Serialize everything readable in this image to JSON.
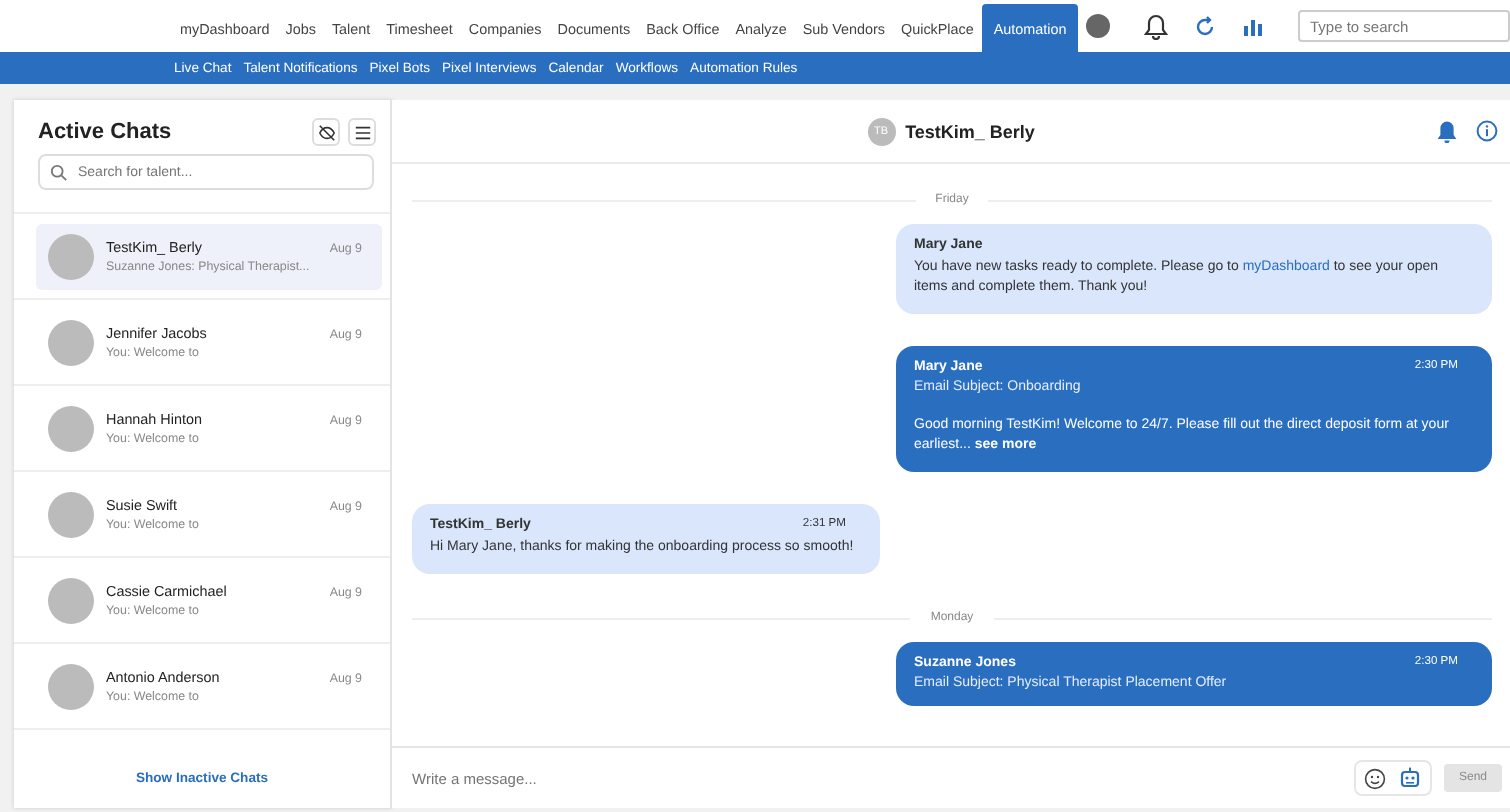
{
  "nav": {
    "items": [
      {
        "label": "myDashboard",
        "selected": false
      },
      {
        "label": "Jobs",
        "selected": false
      },
      {
        "label": "Talent",
        "selected": false
      },
      {
        "label": "Timesheet",
        "selected": false
      },
      {
        "label": "Companies",
        "selected": false
      },
      {
        "label": "Documents",
        "selected": false
      },
      {
        "label": "Back Office",
        "selected": false
      },
      {
        "label": "Analyze",
        "selected": false
      },
      {
        "label": "Sub Vendors",
        "selected": false
      },
      {
        "label": "QuickPlace",
        "selected": false
      },
      {
        "label": "Automation",
        "selected": true
      }
    ],
    "search": {
      "placeholder": "Type to search"
    }
  },
  "subnav": [
    "Live Chat",
    "Talent Notifications",
    "Pixel Bots",
    "Pixel Interviews",
    "Calendar",
    "Workflows",
    "Automation Rules"
  ],
  "sidebar": {
    "title": "Active Chats",
    "search": {
      "placeholder": "Search for talent..."
    },
    "chats": [
      {
        "name": "TestKim_ Berly",
        "preview": "Suzanne Jones: Physical Therapist...",
        "date": "Aug 9",
        "selected": true
      },
      {
        "name": "Jennifer Jacobs",
        "preview": "You: Welcome to",
        "date": "Aug 9",
        "selected": false
      },
      {
        "name": "Hannah Hinton",
        "preview": "You: Welcome to",
        "date": "Aug 9",
        "selected": false
      },
      {
        "name": "Susie Swift",
        "preview": "You: Welcome to",
        "date": "Aug 9",
        "selected": false
      },
      {
        "name": "Cassie Carmichael",
        "preview": "You: Welcome to",
        "date": "Aug 9",
        "selected": false
      },
      {
        "name": "Antonio Anderson",
        "preview": "You: Welcome to",
        "date": "Aug 9",
        "selected": false
      }
    ],
    "footer_link": "Show Inactive Chats"
  },
  "conversation": {
    "initials": "TB",
    "name": "TestKim_ Berly",
    "messages": [
      {
        "kind": "date",
        "label": "Friday"
      },
      {
        "kind": "note",
        "sender": "Mary Jane",
        "text_before": "You have new tasks ready to complete. Please go to",
        "link": "myDashboard",
        "text_after": "to see your open items and complete them. Thank you!"
      },
      {
        "kind": "email",
        "sender": "Mary Jane",
        "time": "2:30 PM",
        "subject": "Email Subject: Onboarding",
        "body": "Good morning TestKim! Welcome to 24/7. Please fill out the direct deposit form at your earliest...",
        "see_more": "see more"
      },
      {
        "kind": "reply",
        "sender": "TestKim_ Berly",
        "time": "2:31 PM",
        "text": "Hi Mary Jane, thanks for making the onboarding process so smooth!"
      },
      {
        "kind": "date",
        "label": "Monday"
      },
      {
        "kind": "email",
        "sender": "Suzanne Jones",
        "time": "2:30 PM",
        "subject": "Email Subject: Physical Therapist Placement Offer"
      }
    ],
    "composer": {
      "placeholder": "Write a message...",
      "send": "Send"
    }
  }
}
